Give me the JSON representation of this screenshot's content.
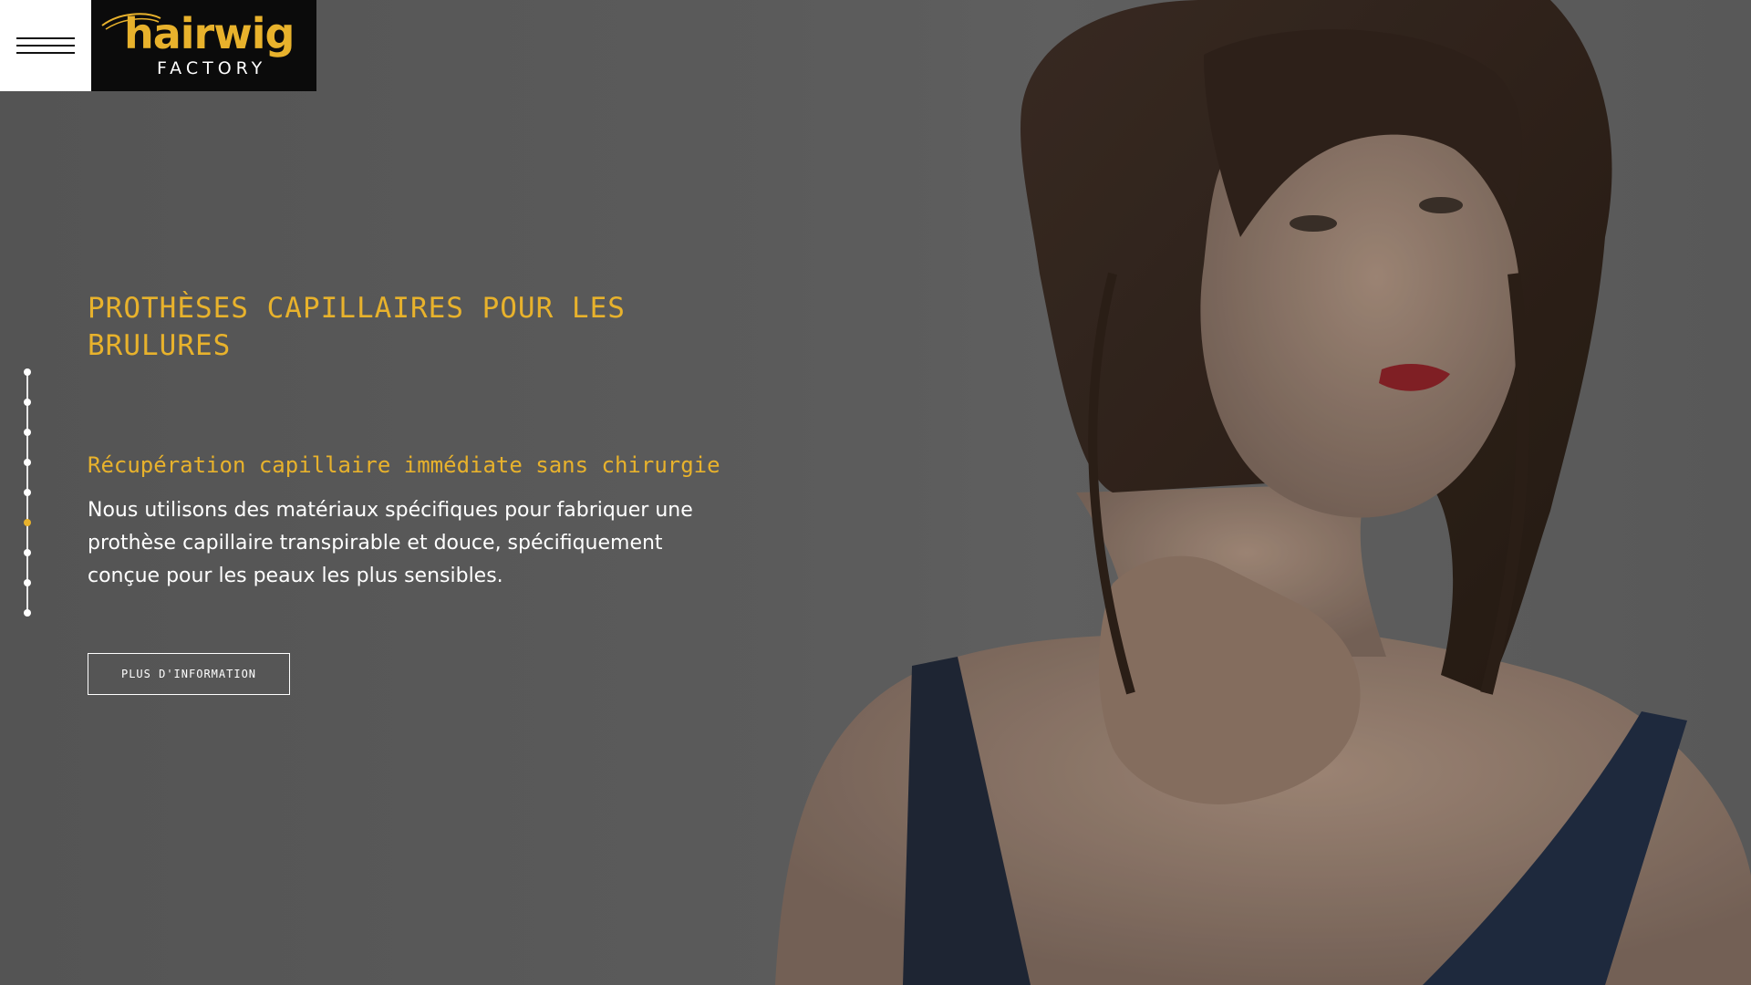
{
  "header": {
    "menu_icon": "hamburger-menu-icon",
    "logo": {
      "word": "hairwig",
      "sub": "FACTORY",
      "word_color": "#e8b22c",
      "background": "#0b0b0b"
    }
  },
  "slider": {
    "total_slides": 9,
    "active_index": 5,
    "accent_color": "#e8b22c"
  },
  "hero": {
    "title": "PROTHÈSES CAPILLAIRES POUR LES BRULURES",
    "subtitle": "Récupération capillaire immédiate sans chirurgie",
    "description": "Nous utilisons des matériaux spécifiques pour fabriquer une prothèse capillaire transpirable et douce, spécifiquement conçue pour les peaux les plus sensibles.",
    "cta_label": "PLUS D'INFORMATION"
  }
}
